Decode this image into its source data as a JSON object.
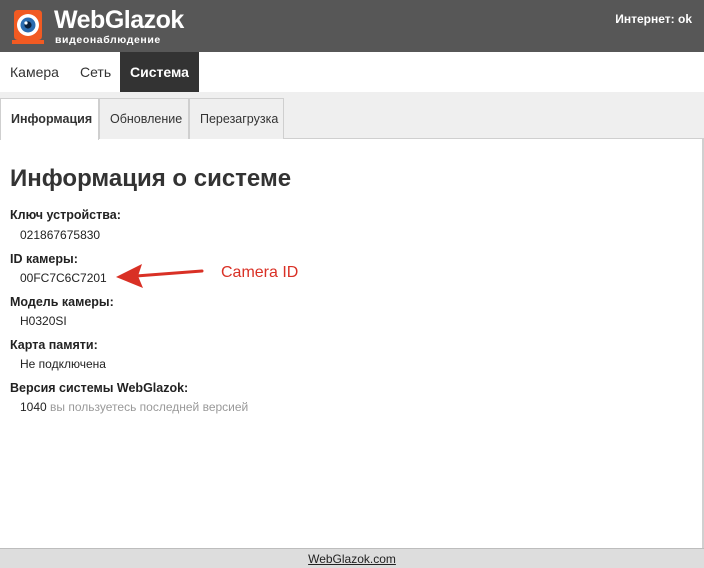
{
  "header": {
    "brand_title": "WebGlazok",
    "brand_subtitle": "видеонаблюдение",
    "internet_label": "Интернет:",
    "internet_status": "ok",
    "logo_color": "#f15a22"
  },
  "nav": {
    "items": [
      {
        "label": "Камера"
      },
      {
        "label": "Сеть"
      },
      {
        "label": "Система",
        "active": true
      }
    ]
  },
  "subnav": {
    "tabs": [
      {
        "label": "Информация",
        "active": true
      },
      {
        "label": "Обновление"
      },
      {
        "label": "Перезагрузка"
      }
    ]
  },
  "main": {
    "title": "Информация о системе",
    "fields": [
      {
        "label": "Ключ устройства:",
        "value": "021867675830"
      },
      {
        "label": "ID камеры:",
        "value": "00FC7C6C7201"
      },
      {
        "label": "Модель камеры:",
        "value": "H0320SI"
      },
      {
        "label": "Карта памяти:",
        "value": "Не подключена"
      },
      {
        "label": "Версия системы WebGlazok:",
        "value": "1040",
        "note": "вы пользуетесь последней версией"
      }
    ]
  },
  "annotation": {
    "text": "Camera ID",
    "color": "#d93025"
  },
  "footer": {
    "link_text": "WebGlazok.com"
  }
}
